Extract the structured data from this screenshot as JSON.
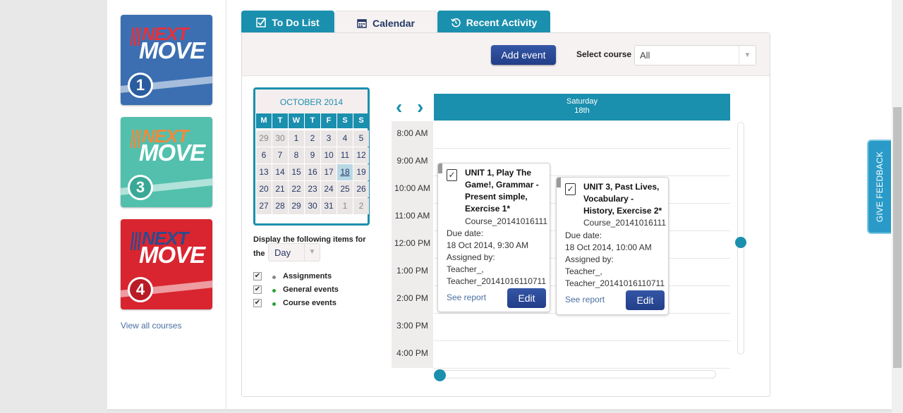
{
  "courses": [
    {
      "top": "NEXT",
      "bottom": "MOVE",
      "level": "1",
      "name": "next-move-1",
      "bg": "#3b6fb2",
      "next_color": "#e8303a",
      "circle": "#2a5d9e"
    },
    {
      "top": "NEXT",
      "bottom": "MOVE",
      "level": "3",
      "name": "next-move-3",
      "bg": "#52c0ad",
      "next_color": "#f08a3c",
      "circle": "#3aa896"
    },
    {
      "top": "NEXT",
      "bottom": "MOVE",
      "level": "4",
      "name": "next-move-4",
      "bg": "#d9252f",
      "next_color": "#2c4b8e",
      "circle": "#b81d26"
    }
  ],
  "view_all_courses": "View all courses",
  "tabs": [
    {
      "label": "To Do List",
      "icon": "checkbox-icon"
    },
    {
      "label": "Calendar",
      "icon": "calendar-icon"
    },
    {
      "label": "Recent Activity",
      "icon": "history-icon"
    }
  ],
  "toolbar": {
    "add_event": "Add event",
    "select_course_label": "Select course",
    "select_course_value": "All"
  },
  "mini_calendar": {
    "month": "OCTOBER 2014",
    "dow": [
      "M",
      "T",
      "W",
      "T",
      "F",
      "S",
      "S"
    ],
    "weeks": [
      [
        "29",
        "30",
        "1",
        "2",
        "3",
        "4",
        "5"
      ],
      [
        "6",
        "7",
        "8",
        "9",
        "10",
        "11",
        "12"
      ],
      [
        "13",
        "14",
        "15",
        "16",
        "17",
        "18",
        "19"
      ],
      [
        "20",
        "21",
        "22",
        "23",
        "24",
        "25",
        "26"
      ],
      [
        "27",
        "28",
        "29",
        "30",
        "31",
        "1",
        "2"
      ]
    ]
  },
  "display": {
    "label": "Display the following items for the",
    "view": "Day"
  },
  "legend": [
    {
      "label": "Assignments",
      "color": "#888888"
    },
    {
      "label": "General events",
      "color": "#2e9e3a"
    },
    {
      "label": "Course events",
      "color": "#2e9e3a"
    }
  ],
  "day_view": {
    "day": "Saturday",
    "date": "18th",
    "prev": "‹",
    "next": "›"
  },
  "times": [
    "8:00 AM",
    "9:00 AM",
    "10:00 AM",
    "11:00 AM",
    "12:00 PM",
    "1:00 PM",
    "2:00 PM",
    "3:00 PM",
    "4:00 PM"
  ],
  "events": [
    {
      "title": "UNIT 1, Play The Game!, Grammar - Present simple, Exercise 1*",
      "course": "Course_20141016111",
      "due_label": "Due date:",
      "due": "18 Oct 2014, 9:30 AM",
      "assigned_label": "Assigned by:",
      "assigned_1": "Teacher_,",
      "assigned_2": "Teacher_20141016110711",
      "see_report": "See report",
      "edit": "Edit"
    },
    {
      "title": "UNIT 3, Past Lives, Vocabulary - History, Exercise 2*",
      "course": "Course_20141016111",
      "due_label": "Due date:",
      "due": "18 Oct 2014, 10:00 AM",
      "assigned_label": "Assigned by:",
      "assigned_1": "Teacher_,",
      "assigned_2": "Teacher_20141016110711",
      "see_report": "See report",
      "edit": "Edit"
    }
  ],
  "feedback": "GIVE FEEDBACK",
  "colors": {
    "accent": "#1b8fae",
    "button": "#223e88"
  }
}
